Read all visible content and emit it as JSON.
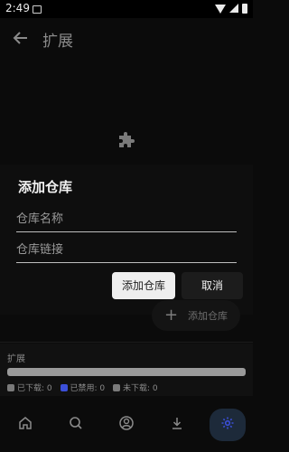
{
  "status_bar": {
    "time": "2:49"
  },
  "app_bar": {
    "title": "扩展"
  },
  "dialog": {
    "title": "添加仓库",
    "repo_name_placeholder": "仓库名称",
    "repo_link_placeholder": "仓库链接",
    "add_label": "添加仓库",
    "cancel_label": "取消"
  },
  "fab": {
    "plus": "+",
    "label": "添加仓库"
  },
  "extension_panel": {
    "title": "扩展",
    "legend": [
      {
        "label": "已下载: 0",
        "color": "#7a7a7a"
      },
      {
        "label": "已禁用: 0",
        "color": "#3b4fd8"
      },
      {
        "label": "未下载: 0",
        "color": "#7a7a7a"
      }
    ]
  },
  "bottom_nav": [
    {
      "icon": "home-icon",
      "active": false
    },
    {
      "icon": "search-icon",
      "active": false
    },
    {
      "icon": "account-icon",
      "active": false
    },
    {
      "icon": "download-icon",
      "active": false
    },
    {
      "icon": "settings-icon",
      "active": true
    }
  ],
  "colors": {
    "accent": "#3b4fd8",
    "background": "#0b0b0b"
  }
}
